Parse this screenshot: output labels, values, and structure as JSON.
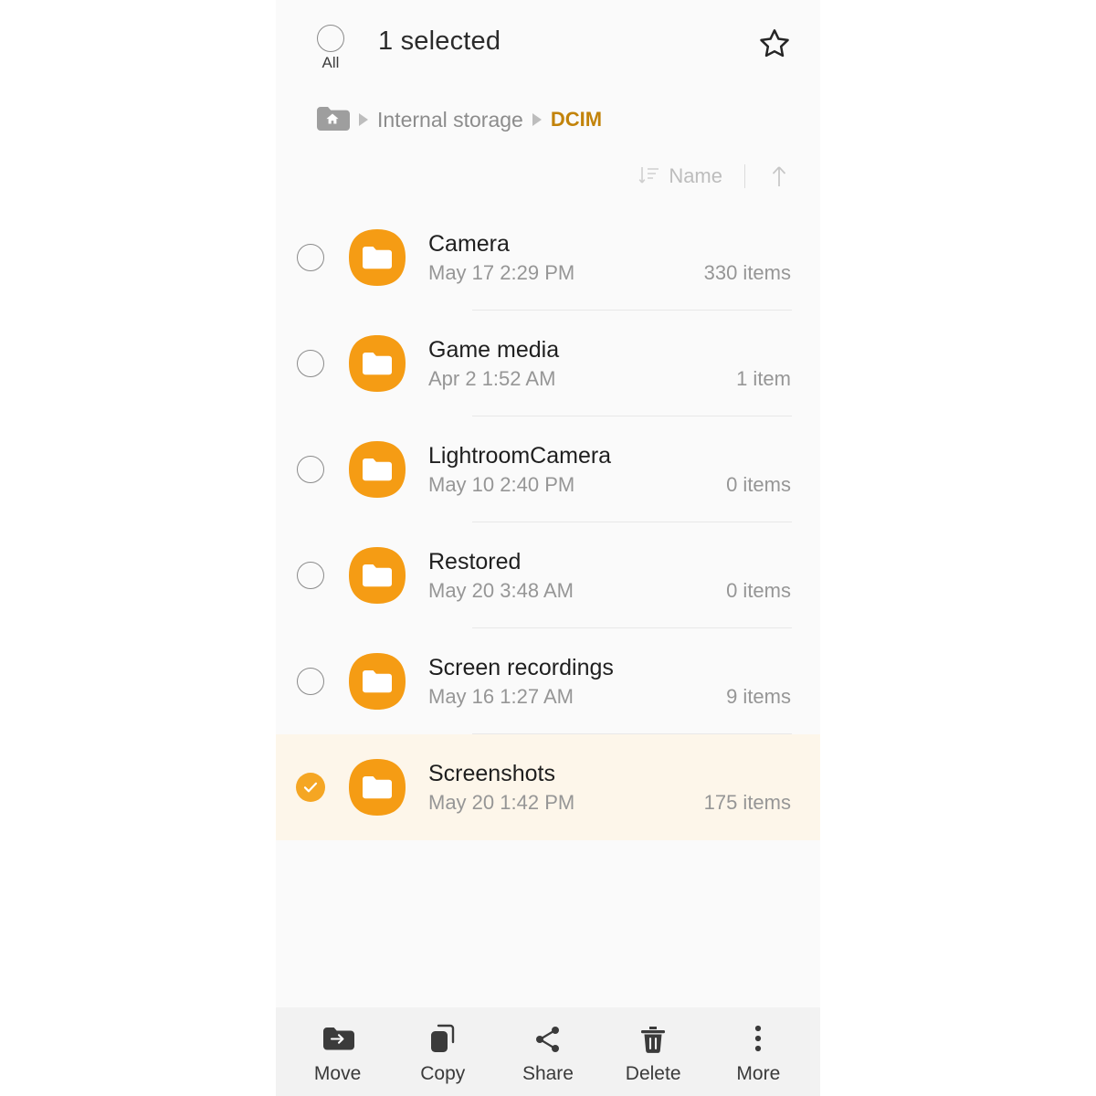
{
  "header": {
    "all_label": "All",
    "title": "1 selected",
    "favorite_icon": "star-outline-icon",
    "all_checkbox_icon": "circle-unchecked-icon"
  },
  "breadcrumb": {
    "home_icon": "home-folder-icon",
    "separator": "chevron-right-icon",
    "items": [
      {
        "label": "Internal storage",
        "current": false
      },
      {
        "label": "DCIM",
        "current": true
      }
    ]
  },
  "sortbar": {
    "sort_icon": "sort-descending-icon",
    "sort_label": "Name",
    "direction_icon": "arrow-up-icon"
  },
  "list": {
    "rows": [
      {
        "name": "Camera",
        "date": "May 17 2:29 PM",
        "count": "330 items",
        "selected": false
      },
      {
        "name": "Game media",
        "date": "Apr 2 1:52 AM",
        "count": "1 item",
        "selected": false
      },
      {
        "name": "LightroomCamera",
        "date": "May 10 2:40 PM",
        "count": "0 items",
        "selected": false
      },
      {
        "name": "Restored",
        "date": "May 20 3:48 AM",
        "count": "0 items",
        "selected": false
      },
      {
        "name": "Screen recordings",
        "date": "May 16 1:27 AM",
        "count": "9 items",
        "selected": false
      },
      {
        "name": "Screenshots",
        "date": "May 20 1:42 PM",
        "count": "175 items",
        "selected": true
      }
    ]
  },
  "toolbar": {
    "items": [
      {
        "label": "Move",
        "icon": "folder-move-icon"
      },
      {
        "label": "Copy",
        "icon": "copy-icon"
      },
      {
        "label": "Share",
        "icon": "share-icon"
      },
      {
        "label": "Delete",
        "icon": "trash-icon"
      },
      {
        "label": "More",
        "icon": "more-vertical-icon"
      }
    ]
  },
  "colors": {
    "accent_orange": "#f59c14",
    "breadcrumb_current": "#c2830a",
    "selected_row_bg": "#fdf6ea",
    "page_bg": "#fafafa",
    "toolbar_bg": "#f2f2f2"
  }
}
